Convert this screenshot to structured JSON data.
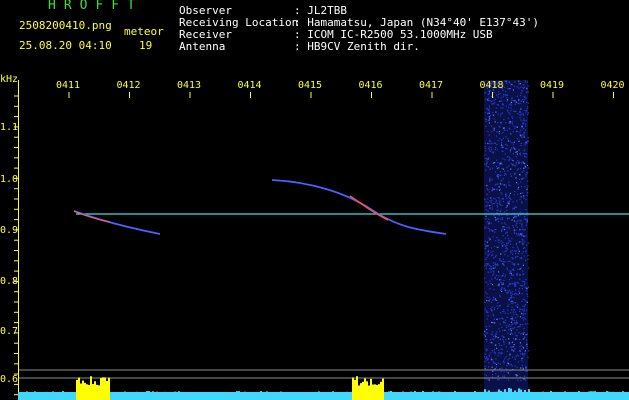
{
  "header": {
    "app_title": "HROFFT",
    "filename": "2508200410.png",
    "meteor_label": "meteor",
    "datetime": "25.08.20 04:10",
    "meteor_count": "19"
  },
  "info": [
    {
      "label": "Observer",
      "value": ": JL2TBB"
    },
    {
      "label": "Receiving Location",
      "value": ": Hamamatsu, Japan (N34°40' E137°43')"
    },
    {
      "label": "Receiver",
      "value": ": ICOM IC-R2500 53.1000MHz USB"
    },
    {
      "label": "Antenna",
      "value": ": HB9CV Zenith dir."
    }
  ],
  "axis": {
    "y_unit": "kHz",
    "y_ticks": [
      "1.1",
      "1.0",
      "0.9",
      "0.8",
      "0.7",
      "0.6"
    ],
    "x_ticks": [
      "0411",
      "0412",
      "0413",
      "0414",
      "0415",
      "0416",
      "0417",
      "0418",
      "0419",
      "0420"
    ]
  },
  "colors": {
    "background": "#000000",
    "tick_text": "#ffff30",
    "title": "#36e236",
    "carrier": "#40e0e0",
    "noise_band": "#2030c0",
    "level_meter": "#40d8ff",
    "level_peak": "#ffff00"
  }
}
